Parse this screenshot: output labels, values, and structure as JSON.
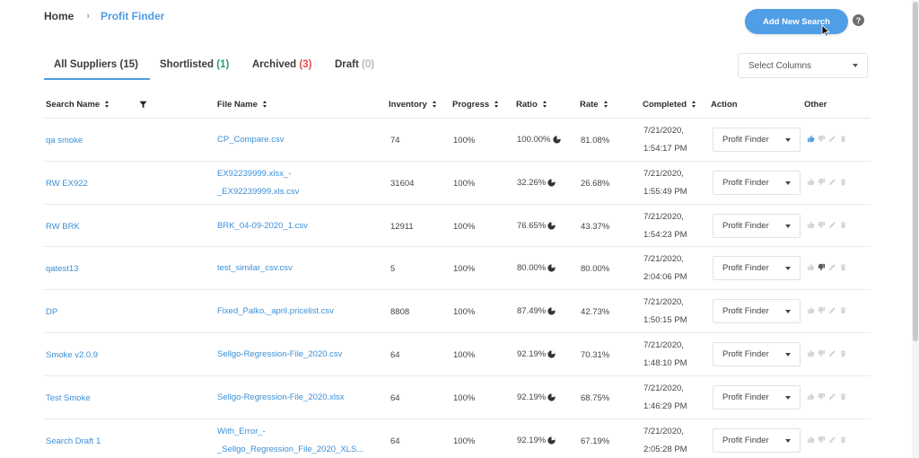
{
  "breadcrumb": {
    "home": "Home",
    "separator": "›",
    "current": "Profit Finder"
  },
  "header": {
    "add_button": "Add New Search",
    "help": "?"
  },
  "tabs": [
    {
      "label": "All Suppliers",
      "count": "(15)"
    },
    {
      "label": "Shortlisted",
      "count": "(1)"
    },
    {
      "label": "Archived",
      "count": "(3)"
    },
    {
      "label": "Draft",
      "count": "(0)"
    }
  ],
  "select_columns": {
    "label": "Select Columns"
  },
  "columns": {
    "search_name": "Search Name",
    "file_name": "File Name",
    "inventory": "Inventory",
    "progress": "Progress",
    "ratio": "Ratio",
    "rate": "Rate",
    "completed": "Completed",
    "action": "Action",
    "other": "Other"
  },
  "rows": [
    {
      "name": "qa smoke",
      "file1": "CP_Compare.csv",
      "file2": "",
      "inventory": "74",
      "progress": "100%",
      "ratio": "100.00%",
      "rate": "81.08%",
      "date": "7/21/2020,",
      "time": "1:54:17 PM",
      "action": "Profit Finder",
      "liked": true,
      "disliked": false
    },
    {
      "name": "RW EX922",
      "file1": "EX92239999.xlsx_-",
      "file2": "_EX92239999.xls.csv",
      "inventory": "31604",
      "progress": "100%",
      "ratio": "32.26%",
      "rate": "26.68%",
      "date": "7/21/2020,",
      "time": "1:55:49 PM",
      "action": "Profit Finder",
      "liked": false,
      "disliked": false
    },
    {
      "name": "RW BRK",
      "file1": "BRK_04-09-2020_1.csv",
      "file2": "",
      "inventory": "12911",
      "progress": "100%",
      "ratio": "76.65%",
      "rate": "43.37%",
      "date": "7/21/2020,",
      "time": "1:54:23 PM",
      "action": "Profit Finder",
      "liked": false,
      "disliked": false
    },
    {
      "name": "qatest13",
      "file1": "test_similar_csv.csv",
      "file2": "",
      "inventory": "5",
      "progress": "100%",
      "ratio": "80.00%",
      "rate": "80.00%",
      "date": "7/21/2020,",
      "time": "2:04:06 PM",
      "action": "Profit Finder",
      "liked": false,
      "disliked": true
    },
    {
      "name": "DP",
      "file1": "Fixed_Palko,_april.pricelist.csv",
      "file2": "",
      "inventory": "8808",
      "progress": "100%",
      "ratio": "87.49%",
      "rate": "42.73%",
      "date": "7/21/2020,",
      "time": "1:50:15 PM",
      "action": "Profit Finder",
      "liked": false,
      "disliked": false
    },
    {
      "name": "Smoke v2.0.9",
      "file1": "Sellgo-Regression-File_2020.csv",
      "file2": "",
      "inventory": "64",
      "progress": "100%",
      "ratio": "92.19%",
      "rate": "70.31%",
      "date": "7/21/2020,",
      "time": "1:48:10 PM",
      "action": "Profit Finder",
      "liked": false,
      "disliked": false
    },
    {
      "name": "Test Smoke",
      "file1": "Sellgo-Regression-File_2020.xlsx",
      "file2": "",
      "inventory": "64",
      "progress": "100%",
      "ratio": "92.19%",
      "rate": "68.75%",
      "date": "7/21/2020,",
      "time": "1:46:29 PM",
      "action": "Profit Finder",
      "liked": false,
      "disliked": false
    },
    {
      "name": "Search Draft 1",
      "file1": "With_Error_-",
      "file2": "_Sellgo_Regression_File_2020_XLS...",
      "inventory": "64",
      "progress": "100%",
      "ratio": "92.19%",
      "rate": "67.19%",
      "date": "7/21/2020,",
      "time": "2:05:28 PM",
      "action": "Profit Finder",
      "liked": false,
      "disliked": false
    }
  ],
  "colors": {
    "accent": "#4f9ee6",
    "link": "#3b8fd6",
    "green": "#2e9a6d",
    "red": "#e24c4c"
  }
}
